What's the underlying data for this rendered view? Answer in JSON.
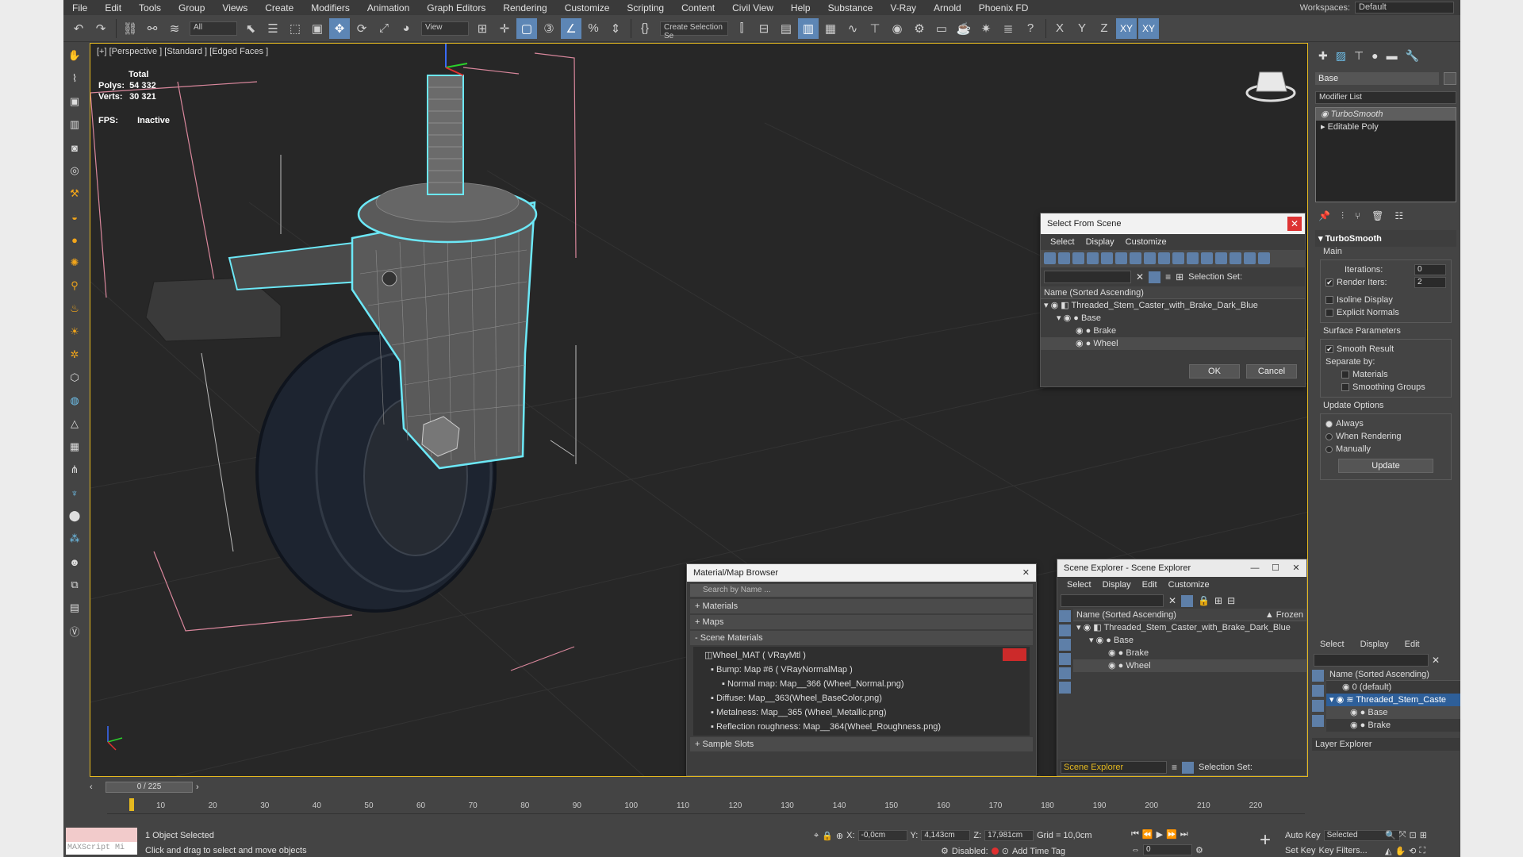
{
  "menubar": {
    "items": [
      "File",
      "Edit",
      "Tools",
      "Group",
      "Views",
      "Create",
      "Modifiers",
      "Animation",
      "Graph Editors",
      "Rendering",
      "Customize",
      "Scripting",
      "Content",
      "Civil View",
      "Help",
      "Substance",
      "V-Ray",
      "Arnold",
      "Phoenix FD"
    ],
    "workspaces_label": "Workspaces:",
    "workspace_value": "Default"
  },
  "toolbar": {
    "filter_value": "All",
    "view_value": "View",
    "selection_set_value": "Create Selection Se",
    "axis_x": "X",
    "axis_y": "Y",
    "axis_z": "Z",
    "axis_xy": "XY",
    "axis_xy2": "XY"
  },
  "viewport": {
    "label": "[+] [Perspective ] [Standard ] [Edged Faces ]",
    "total_label": "Total",
    "polys_label": "Polys:",
    "polys_value": "54 332",
    "verts_label": "Verts:",
    "verts_value": "30 321",
    "fps_label": "FPS:",
    "fps_value": "Inactive"
  },
  "select_dialog": {
    "title": "Select From Scene",
    "menu": [
      "Select",
      "Display",
      "Customize"
    ],
    "selection_set_label": "Selection Set:",
    "column_header": "Name (Sorted Ascending)",
    "tree": [
      "Threaded_Stem_Caster_with_Brake_Dark_Blue",
      "Base",
      "Brake",
      "Wheel"
    ],
    "ok": "OK",
    "cancel": "Cancel"
  },
  "material_browser": {
    "title": "Material/Map Browser",
    "search_placeholder": "Search by Name ...",
    "sections": [
      "+ Materials",
      "+ Maps",
      "- Scene Materials"
    ],
    "rows": [
      "Wheel_MAT ( VRayMtl )",
      "Bump: Map #6 ( VRayNormalMap )",
      "Normal map: Map__366 (Wheel_Normal.png)",
      "Diffuse: Map__363(Wheel_BaseColor.png)",
      "Metalness: Map__365 (Wheel_Metallic.png)",
      "Reflection roughness: Map__364(Wheel_Roughness.png)"
    ],
    "sample_slots": "+ Sample Slots",
    "accent": "#cc2a2a"
  },
  "scene_explorer": {
    "title": "Scene Explorer - Scene Explorer",
    "menu": [
      "Select",
      "Display",
      "Edit",
      "Customize"
    ],
    "column_header": "Name (Sorted Ascending)",
    "frozen_header": "▲ Frozen",
    "tree": [
      "Threaded_Stem_Caster_with_Brake_Dark_Blue",
      "Base",
      "Brake",
      "Wheel"
    ],
    "footer_name": "Scene Explorer",
    "selection_set_label": "Selection Set:"
  },
  "command_panel": {
    "object_name": "Base",
    "modifier_list": "Modifier List",
    "stack": [
      "TurboSmooth",
      "Editable Poly"
    ],
    "rollout_title": "TurboSmooth",
    "main_label": "Main",
    "iterations_label": "Iterations:",
    "iterations_value": "0",
    "render_iters_label": "Render Iters:",
    "render_iters_value": "2",
    "isoline": "Isoline Display",
    "explicit": "Explicit Normals",
    "surface_label": "Surface Parameters",
    "smooth_result": "Smooth Result",
    "separate_by": "Separate by:",
    "materials": "Materials",
    "smoothing_groups": "Smoothing Groups",
    "update_options": "Update Options",
    "always": "Always",
    "when_rendering": "When Rendering",
    "manually": "Manually",
    "update_btn": "Update"
  },
  "layer_explorer": {
    "menu": [
      "Select",
      "Display",
      "Edit"
    ],
    "column_header": "Name (Sorted Ascending)",
    "tree": [
      "0 (default)",
      "Threaded_Stem_Caste",
      "Base",
      "Brake"
    ],
    "footer": "Layer Explorer"
  },
  "timeline": {
    "slider": "0 / 225",
    "ticks": [
      "10",
      "20",
      "30",
      "40",
      "50",
      "60",
      "70",
      "80",
      "90",
      "100",
      "110",
      "120",
      "130",
      "140",
      "150",
      "160",
      "170",
      "180",
      "190",
      "200",
      "210",
      "220"
    ]
  },
  "status": {
    "maxscript": "MAXScript Mi",
    "selected": "1 Object Selected",
    "hint": "Click and drag to select and move objects",
    "x_label": "X:",
    "x_value": "-0,0cm",
    "y_label": "Y:",
    "y_value": "4,143cm",
    "z_label": "Z:",
    "z_value": "17,981cm",
    "grid": "Grid = 10,0cm",
    "disabled": "Disabled:",
    "add_time_tag": "Add Time Tag",
    "auto_key": "Auto Key",
    "selected_dropdown": "Selected",
    "set_key": "Set Key",
    "key_filters": "Key Filters...",
    "frame": "0"
  }
}
